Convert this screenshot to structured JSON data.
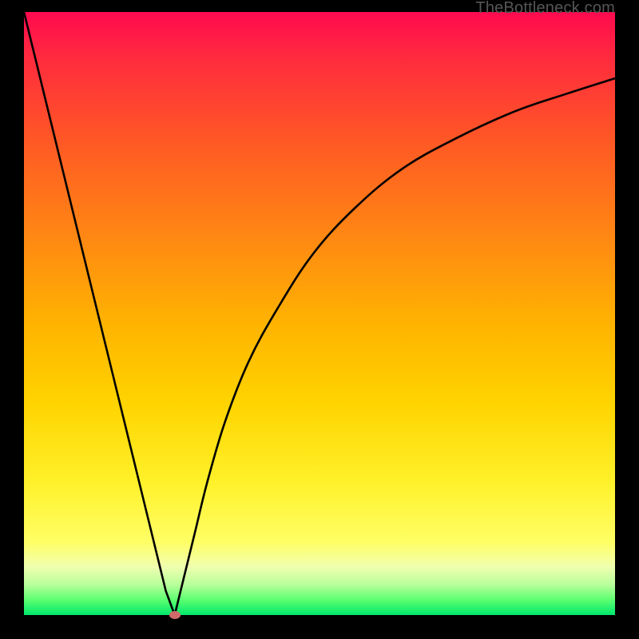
{
  "brand": "TheBottleneck.com",
  "chart_data": {
    "type": "line",
    "title": "",
    "xlabel": "",
    "ylabel": "",
    "xlim": [
      0,
      100
    ],
    "ylim": [
      0,
      100
    ],
    "series": [
      {
        "name": "left-branch",
        "x": [
          0,
          3,
          6,
          9,
          12,
          15,
          18,
          21,
          24,
          25.5
        ],
        "y": [
          100,
          88,
          76,
          64,
          52,
          40,
          28,
          16,
          4,
          0
        ]
      },
      {
        "name": "right-branch",
        "x": [
          25.5,
          27,
          29,
          31,
          34,
          38,
          43,
          49,
          56,
          64,
          73,
          83,
          92,
          100
        ],
        "y": [
          0,
          6,
          14,
          22,
          32,
          42,
          51,
          60,
          67.5,
          74,
          79,
          83.5,
          86.5,
          89
        ]
      }
    ],
    "marker": {
      "x": 25.5,
      "y": 0
    }
  },
  "colors": {
    "curve": "#000000",
    "marker": "#cf6a6a"
  }
}
